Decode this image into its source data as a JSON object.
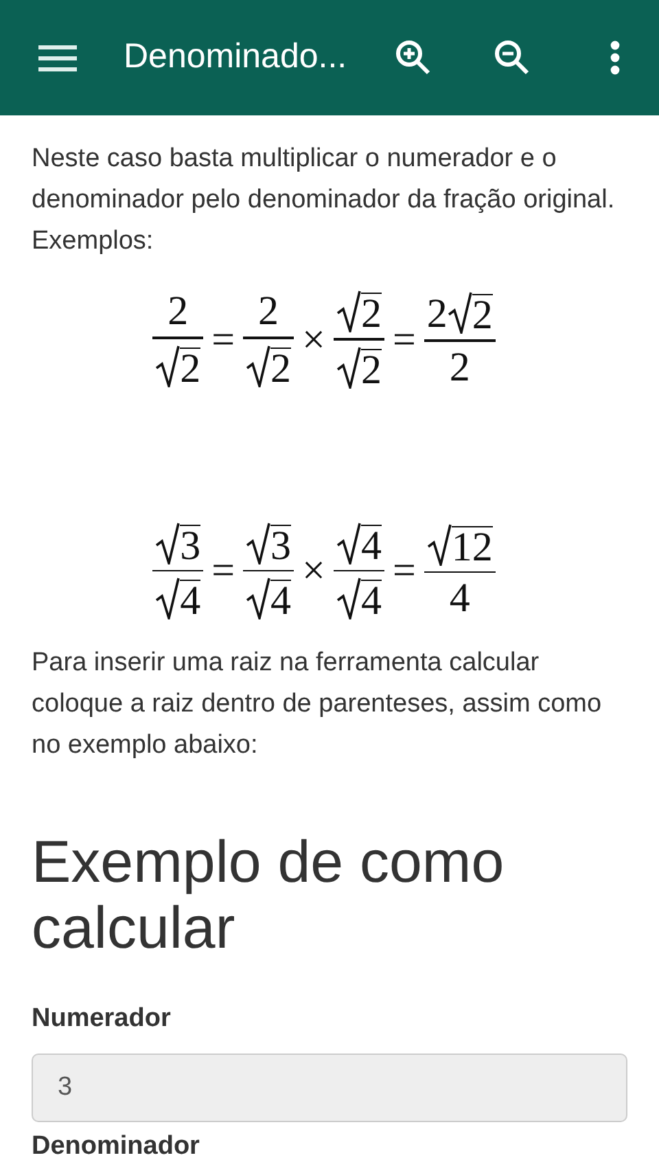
{
  "app_bar": {
    "title": "Denominado..."
  },
  "intro": "Neste caso basta multiplicar o numerador e o denominador pelo denominador da fração original. Exemplos:",
  "equations": [
    {
      "terms": [
        {
          "kind": "frac",
          "num": [
            {
              "kind": "num",
              "text": "2"
            }
          ],
          "den": [
            {
              "kind": "sqrt",
              "text": "2"
            }
          ]
        },
        {
          "kind": "op",
          "text": "="
        },
        {
          "kind": "frac",
          "num": [
            {
              "kind": "num",
              "text": "2"
            }
          ],
          "den": [
            {
              "kind": "sqrt",
              "text": "2"
            }
          ]
        },
        {
          "kind": "op",
          "text": "×"
        },
        {
          "kind": "frac",
          "num": [
            {
              "kind": "sqrt",
              "text": "2"
            }
          ],
          "den": [
            {
              "kind": "sqrt",
              "text": "2"
            }
          ]
        },
        {
          "kind": "op",
          "text": "="
        },
        {
          "kind": "frac",
          "num": [
            {
              "kind": "num",
              "text": "2"
            },
            {
              "kind": "sqrt",
              "text": "2"
            }
          ],
          "den": [
            {
              "kind": "num",
              "text": "2"
            }
          ]
        }
      ]
    },
    {
      "terms": [
        {
          "kind": "frac",
          "num": [
            {
              "kind": "sqrt",
              "text": "3"
            }
          ],
          "den": [
            {
              "kind": "sqrt",
              "text": "4"
            }
          ]
        },
        {
          "kind": "op",
          "text": "="
        },
        {
          "kind": "frac",
          "num": [
            {
              "kind": "sqrt",
              "text": "3"
            }
          ],
          "den": [
            {
              "kind": "sqrt",
              "text": "4"
            }
          ]
        },
        {
          "kind": "op",
          "text": "×"
        },
        {
          "kind": "frac",
          "num": [
            {
              "kind": "sqrt",
              "text": "4"
            }
          ],
          "den": [
            {
              "kind": "sqrt",
              "text": "4"
            }
          ]
        },
        {
          "kind": "op",
          "text": "="
        },
        {
          "kind": "frac",
          "num": [
            {
              "kind": "sqrt",
              "text": "12"
            }
          ],
          "den": [
            {
              "kind": "num",
              "text": "4"
            }
          ]
        }
      ]
    }
  ],
  "note": "Para inserir uma raiz na ferramenta calcular coloque a raiz dentro de parenteses, assim como no exemplo abaixo:",
  "section_title": "Exemplo de como calcular",
  "fields": [
    {
      "label": "Numerador",
      "value": "3",
      "disabled": true
    }
  ],
  "next_label": "Denominador"
}
